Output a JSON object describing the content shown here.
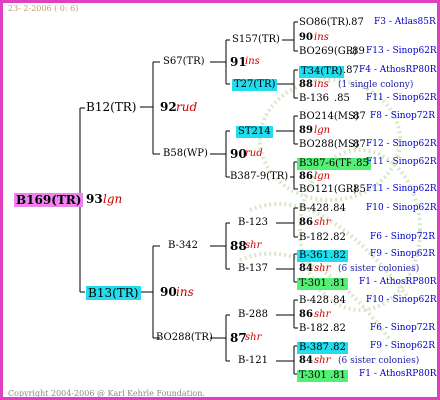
{
  "header": {
    "date": "23- 2-2006 ( 0: 6)"
  },
  "footer": {
    "copyright": "Copyright 2004-2006 @ Karl Kehrle Foundation."
  },
  "root": {
    "name": "B169(TR)",
    "year": "93",
    "line": "lgn"
  },
  "gen1": [
    {
      "name": "B12(TR)",
      "year": "92",
      "line": "rud"
    },
    {
      "name": "B13(TR)",
      "year": "90",
      "line": "ins"
    }
  ],
  "gen2": [
    {
      "name": "S67(TR)",
      "year": "91",
      "line": "ins"
    },
    {
      "name": "B58(WP)",
      "year": "90",
      "line": "rud"
    },
    {
      "name": "B-342",
      "year": "88",
      "line": "shr"
    },
    {
      "name": "BO288(TR)",
      "year": "87",
      "line": "shr"
    }
  ],
  "gen3": [
    {
      "name": "S157(TR)",
      "year": "90",
      "line": "ins"
    },
    {
      "name": "T27(TR)",
      "year": "88",
      "line": "ins"
    },
    {
      "name": "ST214",
      "year": "89",
      "line": "lgn"
    },
    {
      "name": "B387-9(TR)",
      "year": "86",
      "line": "lgn"
    },
    {
      "name": "B-123",
      "year": "86",
      "line": "shr"
    },
    {
      "name": "B-137",
      "year": "84",
      "line": "shr"
    },
    {
      "name": "B-288",
      "year": "86",
      "line": "shr"
    },
    {
      "name": "B-121",
      "year": "84",
      "line": "shr"
    }
  ],
  "gen4": [
    {
      "name": "SO86(TR)",
      "gen": ".87",
      "src": "F3 - Atlas85R"
    },
    {
      "name": "BO269(GR)",
      "gen": ".89",
      "src": "F13 - Sinop62R"
    },
    {
      "name": "T34(TR)",
      "gen": ".87",
      "src": "F4 - AthosRP80R",
      "note": "(1 single colony)"
    },
    {
      "name": "B-136",
      "gen": ".85",
      "src": "F11 - Sinop62R"
    },
    {
      "name": "BO214(MS)",
      "gen": ".87",
      "src": "F8 - Sinop72R"
    },
    {
      "name": "BO288(MS)",
      "gen": ".87",
      "src": "F12 - Sinop62R"
    },
    {
      "name": "B387-6(TR)",
      "gen": ".85",
      "src": "F11 - Sinop62R"
    },
    {
      "name": "BO121(GR)",
      "gen": ".85",
      "src": "F11 - Sinop62R"
    },
    {
      "name": "B-428",
      "gen": ".84",
      "src": "F10 - Sinop62R"
    },
    {
      "name": "B-182",
      "gen": ".82",
      "src": "F6 - Sinop72R"
    },
    {
      "name": "B-361",
      "gen": ".82",
      "src": "F9 - Sinop62R",
      "note": "(6 sister colonies)"
    },
    {
      "name": "T-301",
      "gen": ".81",
      "src": "F1 - AthosRP80R"
    },
    {
      "name": "B-428",
      "gen": ".84",
      "src": "F10 - Sinop62R"
    },
    {
      "name": "B-182",
      "gen": ".82",
      "src": "F6 - Sinop72R"
    },
    {
      "name": "B-387",
      "gen": ".82",
      "src": "F9 - Sinop62R",
      "note": "(6 sister colonies)"
    },
    {
      "name": "T-301",
      "gen": ".81",
      "src": "F1 - AthosRP80R"
    }
  ],
  "colors": {
    "frame": "#e040c0",
    "line_text": "#cc0000",
    "source_text": "#0000cc",
    "highlight_pink": "#ee82ee",
    "highlight_cyan": "#22ddee",
    "highlight_green": "#55ee77"
  }
}
